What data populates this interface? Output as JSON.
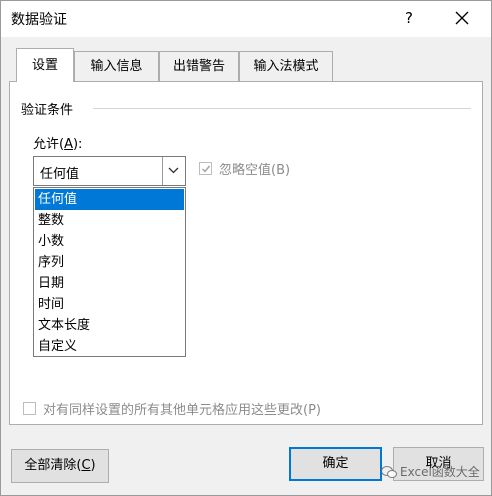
{
  "window": {
    "title": "数据验证",
    "help": "?",
    "close_icon": "close-icon"
  },
  "tabs": [
    {
      "label": "设置",
      "active": true
    },
    {
      "label": "输入信息",
      "active": false
    },
    {
      "label": "出错警告",
      "active": false
    },
    {
      "label": "输入法模式",
      "active": false
    }
  ],
  "settings": {
    "group_label": "验证条件",
    "allow_label_prefix": "允许(",
    "allow_label_key": "A",
    "allow_label_suffix": "):",
    "allow_value": "任何值",
    "ignore_blank_label": "忽略空值(B)",
    "ignore_blank_checked": true,
    "ignore_blank_disabled": true,
    "dropdown_options": [
      "任何值",
      "整数",
      "小数",
      "序列",
      "日期",
      "时间",
      "文本长度",
      "自定义"
    ],
    "dropdown_selected_index": 0,
    "apply_all_label": "对有同样设置的所有其他单元格应用这些更改(P)",
    "apply_all_checked": false
  },
  "buttons": {
    "clear_all_prefix": "全部清除(",
    "clear_all_key": "C",
    "clear_all_suffix": ")",
    "ok": "确定",
    "cancel": "取消"
  },
  "watermark": "Excel函数大全",
  "colors": {
    "selection": "#0078d7",
    "disabled_text": "#8c8c8c",
    "dialog_bg": "#f0f0f0"
  }
}
